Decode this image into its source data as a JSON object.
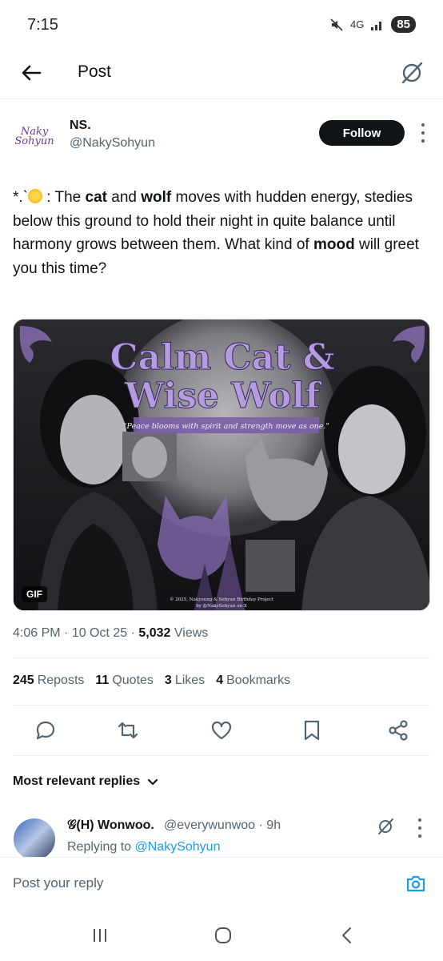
{
  "status_bar": {
    "time": "7:15",
    "network": "4G",
    "battery": "85"
  },
  "header": {
    "title": "Post"
  },
  "author": {
    "avatar_text": "Naky Sohyun",
    "name": "NS.",
    "handle": "@NakySohyun",
    "follow_label": "Follow"
  },
  "tweet": {
    "prefix": "*.`",
    "parts": [
      " : The ",
      "cat",
      " and ",
      "wolf",
      " moves with hudden energy, stedies below this ground to hold their night in quite balance until harmony grows between them. What kind of ",
      "mood",
      " will greet you this time?"
    ]
  },
  "media": {
    "title_line1": "Calm Cat &",
    "title_line2": "Wise Wolf",
    "tagline": "\"Peace blooms with spirit and strength move as one.\"",
    "credit_line1": "© 2025, Nakyoung & Sohyun Birthday Project",
    "credit_line2": "by @NakySohyun on X",
    "badge": "GIF",
    "accent_color": "#8a6fb8"
  },
  "meta": {
    "time": "4:06 PM",
    "date": "10 Oct 25",
    "views": "5,032",
    "views_label": "Views"
  },
  "stats": {
    "reposts": "245",
    "reposts_label": "Reposts",
    "quotes": "11",
    "quotes_label": "Quotes",
    "likes": "3",
    "likes_label": "Likes",
    "bookmarks": "4",
    "bookmarks_label": "Bookmarks"
  },
  "actions": [
    "reply-icon",
    "repost-icon",
    "like-icon",
    "bookmark-icon",
    "share-icon"
  ],
  "replies": {
    "heading": "Most relevant replies",
    "items": [
      {
        "name": "𝒢(H) Wonwoo.",
        "handle": "@everywunwoo",
        "age": "9h",
        "replying_prefix": "Replying to",
        "replying_to": "@NakySohyun"
      }
    ]
  },
  "compose": {
    "placeholder": "Post your reply"
  },
  "colors": {
    "link": "#1d9bf0",
    "text": "#0f1419",
    "muted": "#536471",
    "follow_bg": "#0f1419"
  }
}
